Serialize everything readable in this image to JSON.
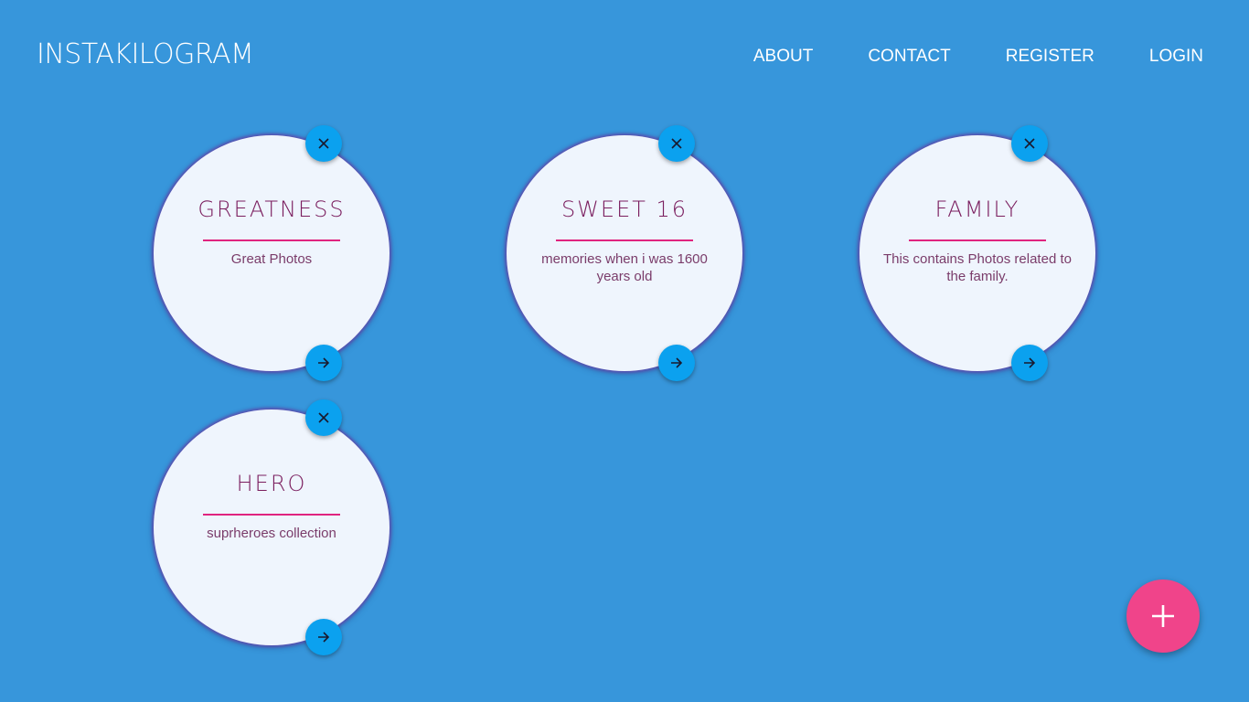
{
  "header": {
    "brand": "INSTAKILOGRAM",
    "nav": [
      {
        "label": "ABOUT"
      },
      {
        "label": "CONTACT"
      },
      {
        "label": "REGISTER"
      },
      {
        "label": "LOGIN"
      }
    ]
  },
  "albums": [
    {
      "title": "GREATNESS",
      "description": "Great Photos"
    },
    {
      "title": "SWEET 16",
      "description": "memories when i was 1600 years old"
    },
    {
      "title": "FAMILY",
      "description": "This contains Photos related to the family."
    },
    {
      "title": "HERO",
      "description": "suprheroes collection"
    }
  ],
  "icons": {
    "close": "close-icon",
    "open": "arrow-right-icon",
    "add": "plus-icon"
  },
  "colors": {
    "background": "#3796db",
    "card": "#eff5fd",
    "title": "#7a1d5e",
    "rule": "#e0247f",
    "small_button": "#0ba1ef",
    "add_button": "#f0448a"
  }
}
